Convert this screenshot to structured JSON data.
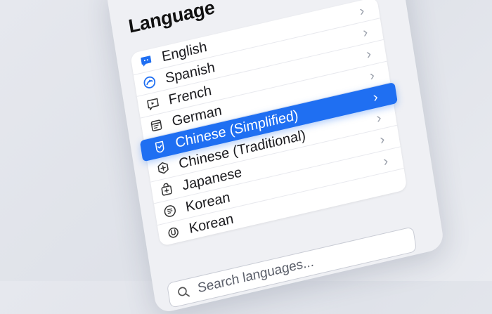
{
  "header": {
    "title": "Language"
  },
  "languages": [
    {
      "label": "English",
      "icon": "chat-bubble-icon",
      "selected": false
    },
    {
      "label": "Spanish",
      "icon": "swirl-icon",
      "selected": false
    },
    {
      "label": "French",
      "icon": "play-box-icon",
      "selected": false
    },
    {
      "label": "German",
      "icon": "document-icon",
      "selected": false
    },
    {
      "label": "Chinese (Simplified)",
      "icon": "shield-check-icon",
      "selected": true
    },
    {
      "label": "Chinese (Traditional)",
      "icon": "hexagon-plus-icon",
      "selected": false
    },
    {
      "label": "Japanese",
      "icon": "bag-plus-icon",
      "selected": false
    },
    {
      "label": "Korean",
      "icon": "list-circle-icon",
      "selected": false
    },
    {
      "label": "Korean",
      "icon": "u-badge-icon",
      "selected": false
    }
  ],
  "search": {
    "placeholder": "Search languages..."
  },
  "colors": {
    "accent": "#1f6ff2",
    "panel": "#eff0f4",
    "icon_blue": "#1f6ff2"
  }
}
